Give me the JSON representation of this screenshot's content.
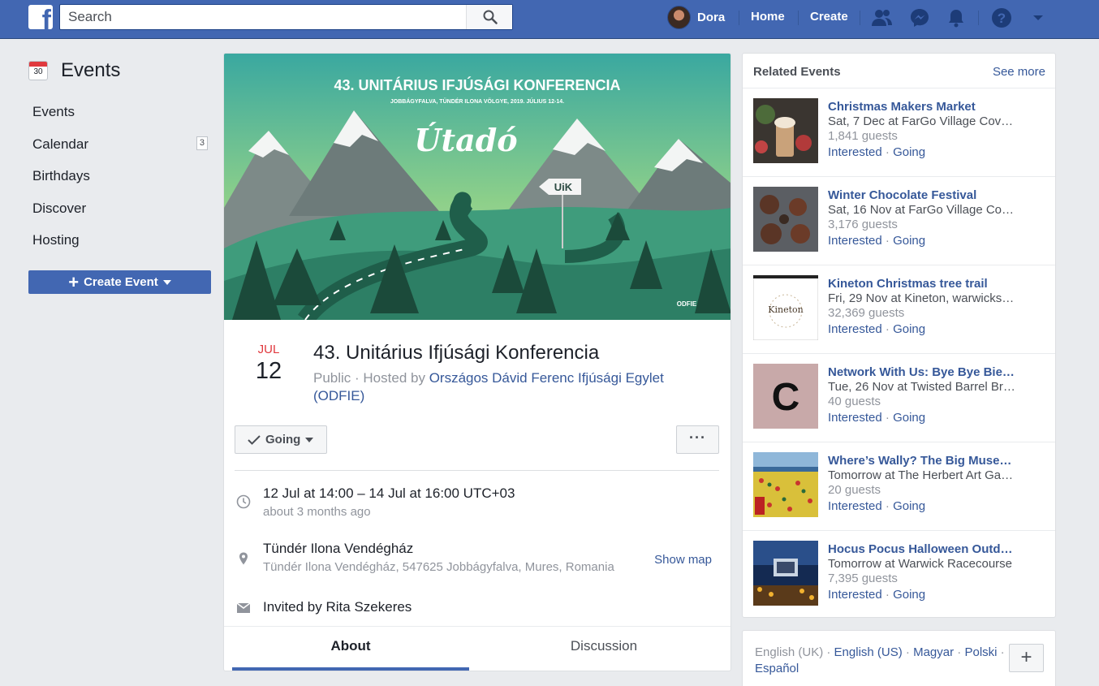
{
  "topbar": {
    "search_placeholder": "Search",
    "user_name": "Dora",
    "home_label": "Home",
    "create_label": "Create"
  },
  "left": {
    "title": "Events",
    "calendar_icon_number": "30",
    "nav": [
      {
        "label": "Events"
      },
      {
        "label": "Calendar",
        "badge": "3"
      },
      {
        "label": "Birthdays"
      },
      {
        "label": "Discover"
      },
      {
        "label": "Hosting"
      }
    ],
    "create_button": "Create Event"
  },
  "event": {
    "cover": {
      "heading": "43. UNITÁRIUS IFJÚSÁGI KONFERENCIA",
      "subheading": "JOBBÁGYFALVA, TÜNDÉR ILONA VÖLGYE, 2019. JÚLIUS 12-14.",
      "script_title": "Útadó",
      "sign": "UiK",
      "logo": "ODFIE"
    },
    "month": "JUL",
    "day": "12",
    "title": "43. Unitárius Ifjúsági Konferencia",
    "privacy": "Public · Hosted by ",
    "host": "Országos Dávid Ferenc Ifjúsági Egylet (ODFIE)",
    "going_label": "Going",
    "more_label": "···",
    "when": "12 Jul at 14:00 – 14 Jul at 16:00 UTC+03",
    "when_relative": "about 3 months ago",
    "place": "Tündér Ilona Vendégház",
    "address": "Tündér Ilona Vendégház, 547625 Jobbágyfalva, Mures, Romania",
    "show_map": "Show map",
    "invited": "Invited by Rita Szekeres",
    "tabs": [
      {
        "label": "About"
      },
      {
        "label": "Discussion"
      }
    ]
  },
  "related": {
    "title": "Related Events",
    "see_more": "See more",
    "interested": "Interested",
    "going": "Going",
    "items": [
      {
        "title": "Christmas Makers Market",
        "date": "Sat, 7 Dec at FarGo Village Cov…",
        "guests": "1,841 guests"
      },
      {
        "title": "Winter Chocolate Festival",
        "date": "Sat, 16 Nov at FarGo Village Co…",
        "guests": "3,176 guests"
      },
      {
        "title": "Kineton Christmas tree trail",
        "date": "Fri, 29 Nov at Kineton, warwicks…",
        "guests": "32,369 guests",
        "thumb_text": "Kineton"
      },
      {
        "title": "Network With Us: Bye Bye Bie…",
        "date": "Tue, 26 Nov at Twisted Barrel Br…",
        "guests": "40 guests",
        "thumb_text": "C"
      },
      {
        "title": "Where’s Wally? The Big Muse…",
        "date": "Tomorrow at The Herbert Art Ga…",
        "guests": "20 guests"
      },
      {
        "title": "Hocus Pocus Halloween Outd…",
        "date": "Tomorrow at Warwick Racecourse",
        "guests": "7,395 guests"
      }
    ]
  },
  "footer": {
    "current_lang": "English (UK)",
    "sep": " · ",
    "langs": [
      "English (US)",
      "Magyar",
      "Polski",
      "Español"
    ]
  },
  "colors": {
    "brand": "#4267b2",
    "link": "#365899",
    "date_red": "#e0393e"
  }
}
